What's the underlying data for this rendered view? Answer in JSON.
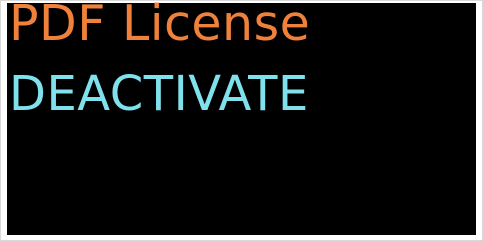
{
  "screen": {
    "title": "PDF License",
    "action_label": "DEACTIVATE"
  },
  "colors": {
    "background": "#000000",
    "title": "#f0813a",
    "action": "#7fe1ec"
  }
}
